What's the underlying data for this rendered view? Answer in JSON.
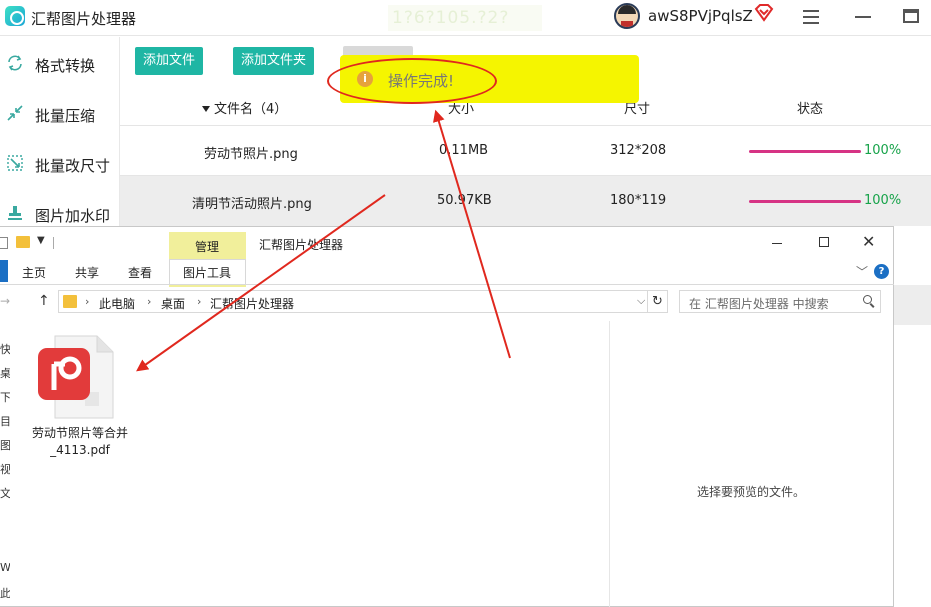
{
  "app": {
    "title": "汇帮图片处理器",
    "ghost_text": "1?6?105.?2?",
    "username": "awS8PVjPqlsZ"
  },
  "sidebar": {
    "items": [
      {
        "label": "格式转换",
        "icon": "format-convert-icon"
      },
      {
        "label": "批量压缩",
        "icon": "compress-icon"
      },
      {
        "label": "批量改尺寸",
        "icon": "resize-icon"
      },
      {
        "label": "图片加水印",
        "icon": "watermark-icon"
      }
    ]
  },
  "toolbar": {
    "add_file": "添加文件",
    "add_folder": "添加文件夹"
  },
  "table": {
    "headers": {
      "name": "文件名（4）",
      "size": "大小",
      "dimensions": "尺寸",
      "status": "状态"
    },
    "rows": [
      {
        "name": "劳动节照片.png",
        "size": "0.11MB",
        "dimensions": "312*208",
        "progress": 100,
        "progress_label": "100%"
      },
      {
        "name": "清明节活动照片.png",
        "size": "50.97KB",
        "dimensions": "180*119",
        "progress": 100,
        "progress_label": "100%"
      }
    ]
  },
  "toast": {
    "message": "操作完成!",
    "icon": "info-icon"
  },
  "explorer": {
    "manage_tab": "管理",
    "window_title": "汇帮图片处理器",
    "ribbon_tabs": [
      "主页",
      "共享",
      "查看",
      "图片工具"
    ],
    "breadcrumb": [
      "此电脑",
      "桌面",
      "汇帮图片处理器"
    ],
    "search_placeholder": "在 汇帮图片处理器 中搜索",
    "left_edge_chars": [
      "快",
      "桌",
      "下",
      "目",
      "图",
      "视",
      "文",
      "W",
      "此"
    ],
    "file": {
      "name": "劳动节照片等合并_4113.pdf",
      "icon": "pdf-file-icon"
    },
    "preview_message": "选择要预览的文件。"
  },
  "colors": {
    "accent": "#1fb6a4",
    "toast_bg": "#f5f500",
    "progress": "#d63384",
    "success_text": "#17a34a",
    "annotation_red": "#e0281e"
  }
}
